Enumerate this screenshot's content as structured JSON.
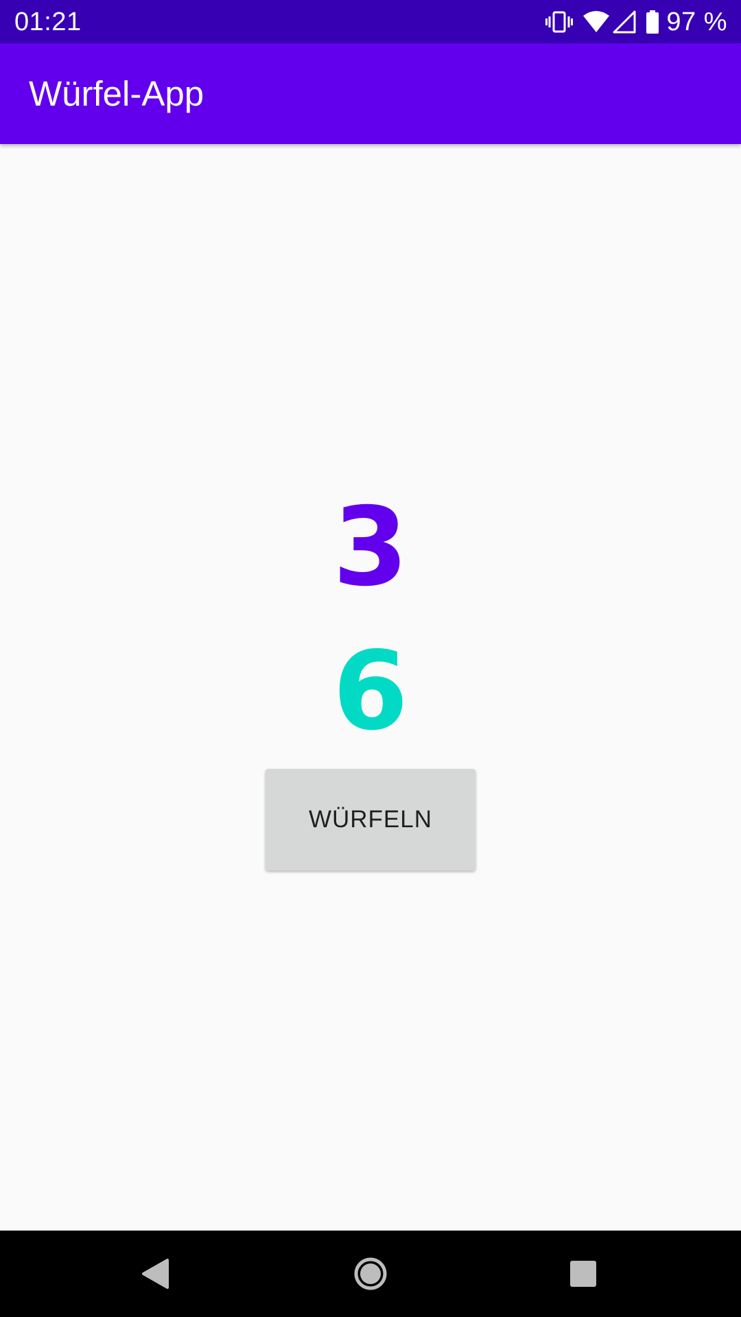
{
  "status_bar": {
    "time": "01:21",
    "battery_text": "97 %",
    "icons": [
      "vibrate-icon",
      "wifi-icon",
      "signal-icon",
      "battery-icon"
    ]
  },
  "app_bar": {
    "title": "Würfel-App",
    "color": "#6200ee"
  },
  "dice": {
    "first_value": "3",
    "first_color": "#6200ee",
    "second_value": "6",
    "second_color": "#03dac5"
  },
  "roll_button": {
    "label": "WÜRFELN"
  },
  "nav_bar": {
    "buttons": [
      "back-icon",
      "home-icon",
      "recents-icon"
    ]
  }
}
